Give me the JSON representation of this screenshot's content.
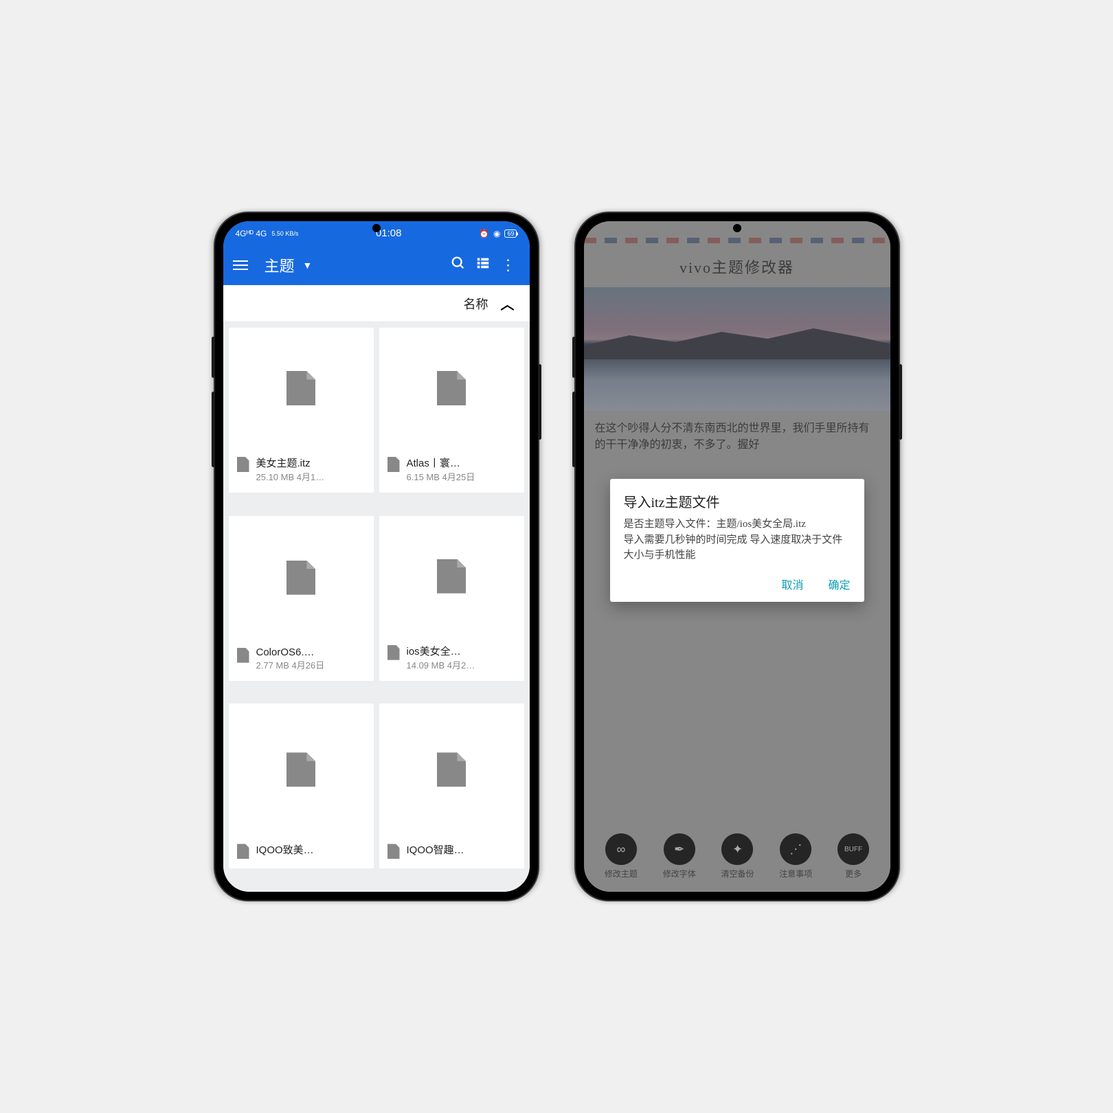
{
  "phone1": {
    "status": {
      "network": "4Gᴴᴰ 4G",
      "speed": "5.50 KB/s",
      "time": "01:08",
      "battery": "69"
    },
    "appbar": {
      "title": "主题"
    },
    "sort": {
      "label": "名称"
    },
    "files": [
      {
        "name": "美女主题.itz",
        "size": "25.10 MB 4月1…"
      },
      {
        "name": "Atlas丨寰…",
        "size": "6.15 MB 4月25日"
      },
      {
        "name": "ColorOS6.…",
        "size": "2.77 MB 4月26日"
      },
      {
        "name": "ios美女全…",
        "size": "14.09 MB 4月2…"
      },
      {
        "name": "IQOO致美…",
        "size": ""
      },
      {
        "name": "IQOO智趣…",
        "size": ""
      }
    ]
  },
  "phone2": {
    "header": "vivo主题修改器",
    "body_text": "在这个吵得人分不清东南西北的世界里，我们手里所持有的干干净净的初衷，不多了。握好",
    "dialog": {
      "title": "导入itz主题文件",
      "line1": "是否主题导入文件：主题/ios美女全局.itz",
      "line2": "导入需要几秒钟的时间完成  导入速度取决于文件大小与手机性能",
      "cancel": "取消",
      "confirm": "确定"
    },
    "nav": [
      {
        "icon": "∞",
        "label": "修改主题"
      },
      {
        "icon": "✒",
        "label": "修改字体"
      },
      {
        "icon": "✦",
        "label": "清空备份"
      },
      {
        "icon": "⋰",
        "label": "注意事项"
      },
      {
        "icon": "BUFF",
        "label": "更多"
      }
    ]
  }
}
